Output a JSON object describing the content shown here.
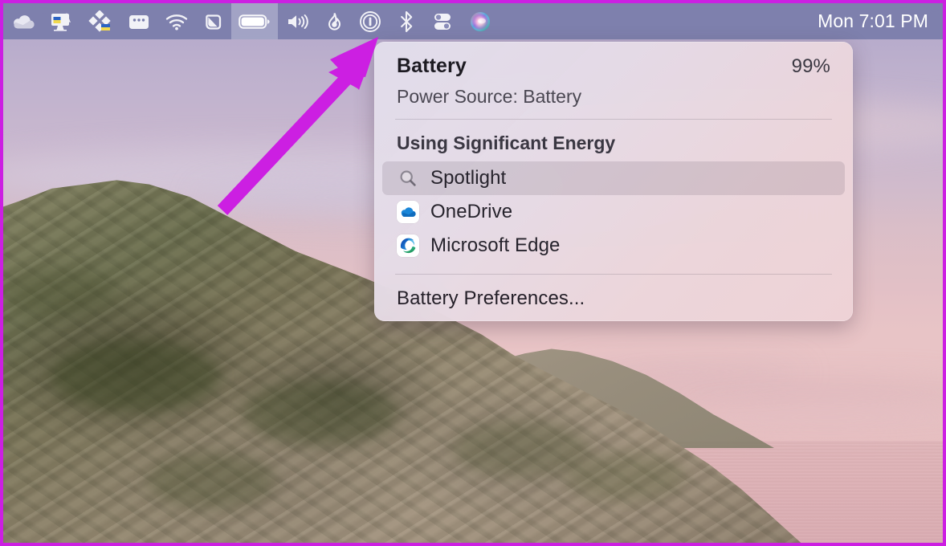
{
  "menubar": {
    "left_items": [
      {
        "name": "onedrive-menu-icon",
        "label": "OneDrive"
      },
      {
        "name": "display-menu-icon",
        "label": "Display"
      },
      {
        "name": "dropbox-menu-icon",
        "label": "Dropbox"
      },
      {
        "name": "window-manager-menu-icon",
        "label": "Window Manager"
      },
      {
        "name": "wifi-menu-icon",
        "label": "Wi-Fi"
      },
      {
        "name": "magnet-menu-icon",
        "label": "Magnet"
      },
      {
        "name": "battery-menu-icon",
        "label": "Battery"
      },
      {
        "name": "volume-menu-icon",
        "label": "Sound"
      },
      {
        "name": "flame-menu-icon",
        "label": "Flame"
      },
      {
        "name": "info-menu-icon",
        "label": "Info"
      },
      {
        "name": "bluetooth-menu-icon",
        "label": "Bluetooth"
      },
      {
        "name": "control-center-icon",
        "label": "Control Center"
      },
      {
        "name": "siri-icon",
        "label": "Siri"
      }
    ],
    "clock": "Mon 7:01 PM",
    "active_item": "battery-menu-icon"
  },
  "battery_popover": {
    "title": "Battery",
    "percent": "99%",
    "power_source": "Power Source: Battery",
    "section_title": "Using Significant Energy",
    "apps": [
      {
        "name": "Spotlight",
        "icon": "search-icon",
        "highlighted": true
      },
      {
        "name": "OneDrive",
        "icon": "onedrive-icon",
        "highlighted": false
      },
      {
        "name": "Microsoft Edge",
        "icon": "edge-icon",
        "highlighted": false
      }
    ],
    "footer_action": "Battery Preferences..."
  },
  "annotation": {
    "type": "arrow",
    "color": "#cc1fe2",
    "points_to": "battery-menu-icon"
  },
  "border": {
    "color": "#cc1fe2"
  }
}
